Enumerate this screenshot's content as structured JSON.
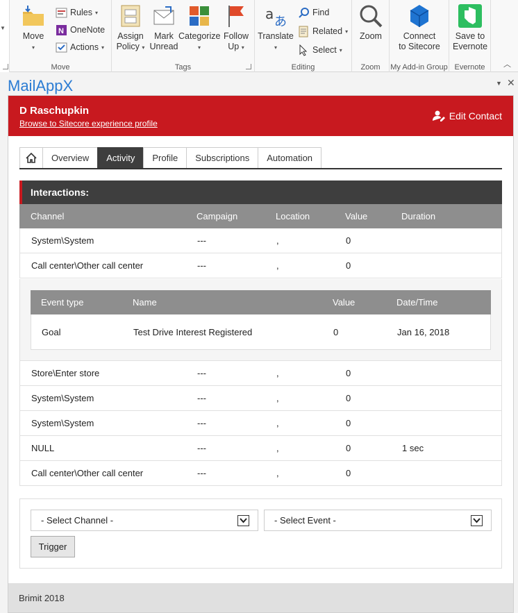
{
  "ribbon": {
    "move_group": {
      "label": "Move",
      "move": "Move",
      "rules": "Rules",
      "onenote": "OneNote",
      "actions": "Actions"
    },
    "tags_group": {
      "label": "Tags",
      "assign_policy": [
        "Assign",
        "Policy"
      ],
      "mark_unread": [
        "Mark",
        "Unread"
      ],
      "categorize": "Categorize",
      "follow_up": [
        "Follow",
        "Up"
      ]
    },
    "editing_group": {
      "label": "Editing",
      "translate": "Translate",
      "find": "Find",
      "related": "Related",
      "select": "Select"
    },
    "zoom_group": {
      "label": "Zoom",
      "zoom": "Zoom"
    },
    "addin_group": {
      "label": "My Add-in Group",
      "connect": [
        "Connect",
        "to Sitecore"
      ]
    },
    "evernote_group": {
      "label": "Evernote",
      "save": [
        "Save to",
        "Evernote"
      ]
    }
  },
  "pane": {
    "title": "MailAppX"
  },
  "contact": {
    "name": "D Raschupkin",
    "profile_link": "Browse to Sitecore experience profile",
    "edit_label": "Edit Contact"
  },
  "tabs": [
    "Overview",
    "Activity",
    "Profile",
    "Subscriptions",
    "Automation"
  ],
  "active_tab": "Activity",
  "interactions": {
    "title": "Interactions:",
    "columns": [
      "Channel",
      "Campaign",
      "Location",
      "Value",
      "Duration"
    ],
    "rows_top": [
      {
        "channel": "System\\System",
        "campaign": "---",
        "location": ",",
        "value": "0",
        "duration": ""
      },
      {
        "channel": "Call center\\Other call center",
        "campaign": "---",
        "location": ",",
        "value": "0",
        "duration": ""
      }
    ],
    "events": {
      "columns": [
        "Event type",
        "Name",
        "Value",
        "Date/Time"
      ],
      "rows": [
        {
          "type": "Goal",
          "name": "Test Drive Interest Registered",
          "value": "0",
          "datetime": "Jan 16, 2018"
        }
      ]
    },
    "rows_bottom": [
      {
        "channel": "Store\\Enter store",
        "campaign": "---",
        "location": ",",
        "value": "0",
        "duration": ""
      },
      {
        "channel": "System\\System",
        "campaign": "---",
        "location": ",",
        "value": "0",
        "duration": ""
      },
      {
        "channel": "System\\System",
        "campaign": "---",
        "location": ",",
        "value": "0",
        "duration": ""
      },
      {
        "channel": "NULL",
        "campaign": "---",
        "location": ",",
        "value": "0",
        "duration": "1 sec"
      },
      {
        "channel": "Call center\\Other call center",
        "campaign": "---",
        "location": ",",
        "value": "0",
        "duration": ""
      }
    ]
  },
  "controls": {
    "channel_select": "- Select Channel -",
    "event_select": "- Select Event -",
    "trigger": "Trigger"
  },
  "footer": "Brimit 2018",
  "colors": {
    "accent_red": "#c8191f",
    "dark": "#3e3e3e",
    "header_gray": "#8e8e8e",
    "title_blue": "#2b7cd3"
  }
}
